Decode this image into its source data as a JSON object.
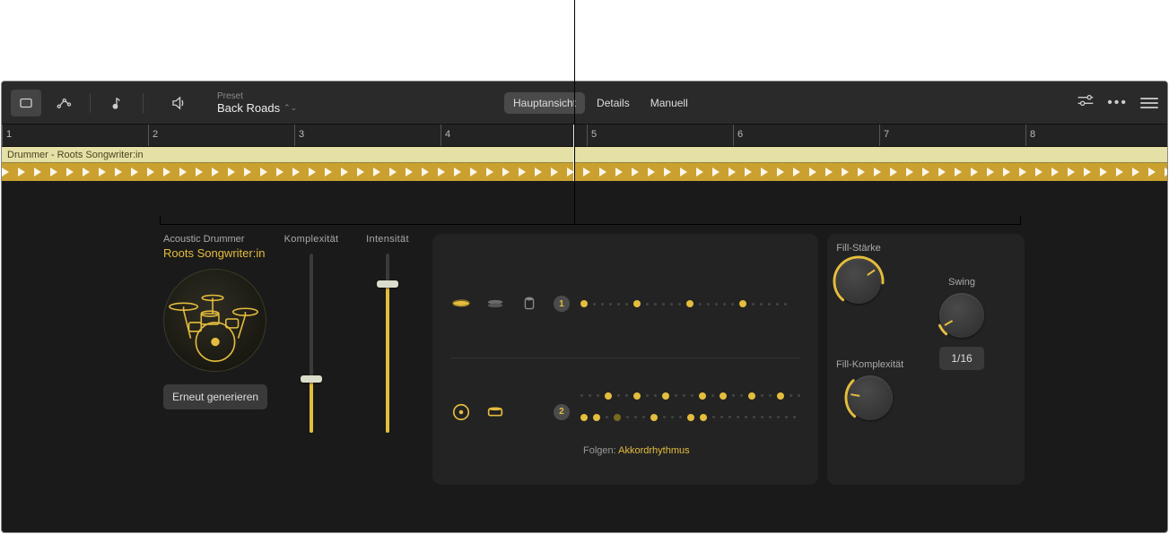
{
  "toolbar": {
    "preset_label": "Preset",
    "preset_name": "Back Roads",
    "tabs": [
      "Hauptansicht",
      "Details",
      "Manuell"
    ],
    "active_tab": 0
  },
  "ruler": {
    "bars": [
      "1",
      "2",
      "3",
      "4",
      "5",
      "6",
      "7",
      "8"
    ]
  },
  "region": {
    "title": "Drummer - Roots Songwriter:in"
  },
  "style": {
    "category": "Acoustic Drummer",
    "name": "Roots Songwriter:in"
  },
  "regen_label": "Erneut generieren",
  "sliders": {
    "complexity_label": "Komplexität",
    "intensity_label": "Intensität"
  },
  "lanes": {
    "num1": "1",
    "num2": "2",
    "follow_label": "Folgen:",
    "follow_value": "Akkordrhythmus"
  },
  "knobs": {
    "fill_strength_label": "Fill-Stärke",
    "fill_complexity_label": "Fill-Komplexität",
    "swing_label": "Swing",
    "swing_value": "1/16"
  }
}
